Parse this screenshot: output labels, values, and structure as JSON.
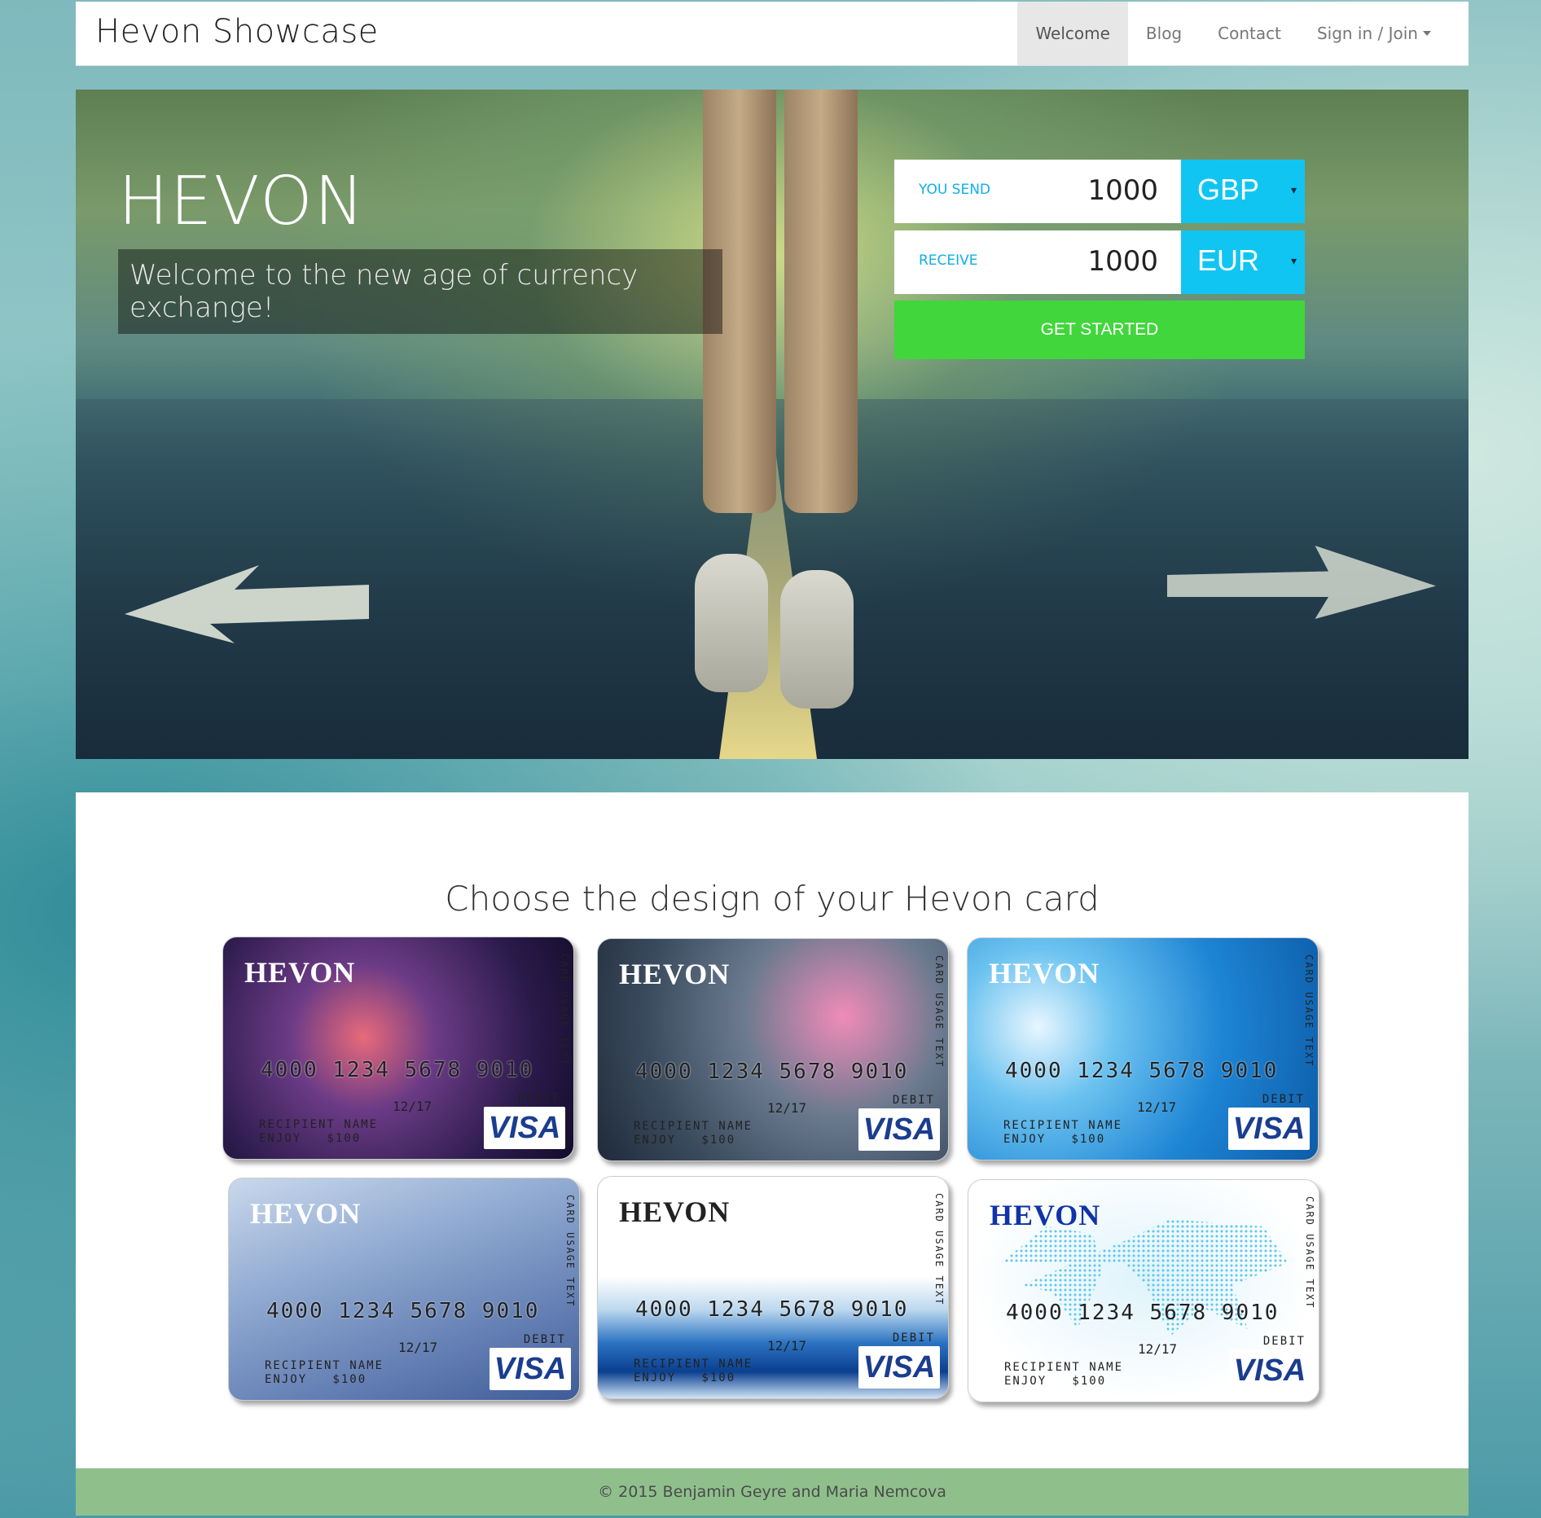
{
  "navbar": {
    "brand": "Hevon Showcase",
    "items": [
      {
        "label": "Welcome"
      },
      {
        "label": "Blog"
      },
      {
        "label": "Contact"
      },
      {
        "label": "Sign in / Join"
      }
    ]
  },
  "hero": {
    "title": "HEVON",
    "tagline": "Welcome to the new age of currency exchange!"
  },
  "exchange": {
    "send_label": "YOU SEND",
    "send_amount": "1000",
    "send_currency": "GBP",
    "receive_label": "RECEIVE",
    "receive_amount": "1000",
    "receive_currency": "EUR",
    "dropdown_glyph": "▾",
    "cta_label": "GET STARTED"
  },
  "cards_section": {
    "title": "Choose the design of your Hevon card",
    "card_text": {
      "brand": "HEVON",
      "number": "4000 1234 5678 9010",
      "type": "DEBIT",
      "expiry": "12/17",
      "recipient": "RECIPIENT NAME",
      "amount": "ENJOY   $100",
      "usage": "CARD USAGE TEXT",
      "network": "VISA"
    },
    "designs": [
      "galaxy-network",
      "pink-blossom",
      "blue-tech",
      "white-daisies",
      "blue-wave",
      "world-map"
    ]
  },
  "footer": {
    "text": "© 2015 Benjamin Geyre and Maria Nemcova"
  },
  "colors": {
    "accent_blue": "#11c5f2",
    "cta_green": "#41d63b",
    "footer_green": "#8fc08c",
    "visa_blue": "#1a3d8f"
  }
}
